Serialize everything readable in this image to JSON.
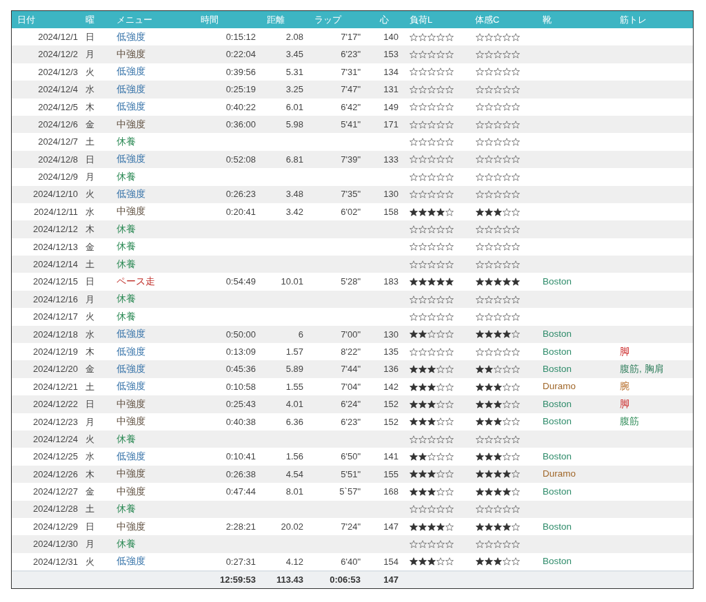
{
  "table": {
    "columns": [
      "日付",
      "曜",
      "メニュー",
      "時間",
      "距離",
      "ラップ",
      "心",
      "負荷L",
      "体感C",
      "靴",
      "筋トレ"
    ],
    "rows": [
      {
        "date": "2024/12/1",
        "weekday": "日",
        "menu": {
          "text": "低強度",
          "color": "#2f6ea6"
        },
        "time": "0:15:12",
        "distance": "2.08",
        "lap": "7'17\"",
        "heart": "140",
        "load": {
          "stars": 0
        },
        "feel": {
          "stars": 0
        }
      },
      {
        "date": "2024/12/2",
        "weekday": "月",
        "menu": {
          "text": "中強度",
          "color": "#5b4b3b"
        },
        "time": "0:22:04",
        "distance": "3.45",
        "lap": "6'23\"",
        "heart": "153",
        "load": {
          "stars": 0
        },
        "feel": {
          "stars": 0
        }
      },
      {
        "date": "2024/12/3",
        "weekday": "火",
        "menu": {
          "text": "低強度",
          "color": "#2f6ea6"
        },
        "time": "0:39:56",
        "distance": "5.31",
        "lap": "7'31\"",
        "heart": "134",
        "load": {
          "stars": 0
        },
        "feel": {
          "stars": 0
        }
      },
      {
        "date": "2024/12/4",
        "weekday": "水",
        "menu": {
          "text": "低強度",
          "color": "#2f6ea6"
        },
        "time": "0:25:19",
        "distance": "3.25",
        "lap": "7'47\"",
        "heart": "131",
        "load": {
          "stars": 0
        },
        "feel": {
          "stars": 0
        }
      },
      {
        "date": "2024/12/5",
        "weekday": "木",
        "menu": {
          "text": "低強度",
          "color": "#2f6ea6"
        },
        "time": "0:40:22",
        "distance": "6.01",
        "lap": "6'42\"",
        "heart": "149",
        "load": {
          "stars": 0
        },
        "feel": {
          "stars": 0
        }
      },
      {
        "date": "2024/12/6",
        "weekday": "金",
        "menu": {
          "text": "中強度",
          "color": "#5b4b3b"
        },
        "time": "0:36:00",
        "distance": "5.98",
        "lap": "5'41\"",
        "heart": "171",
        "load": {
          "stars": 0
        },
        "feel": {
          "stars": 0
        }
      },
      {
        "date": "2024/12/7",
        "weekday": "土",
        "menu": {
          "text": "休養",
          "color": "#2e8b57"
        },
        "load": {
          "stars": 0
        },
        "feel": {
          "stars": 0
        }
      },
      {
        "date": "2024/12/8",
        "weekday": "日",
        "menu": {
          "text": "低強度",
          "color": "#2f6ea6"
        },
        "time": "0:52:08",
        "distance": "6.81",
        "lap": "7'39\"",
        "heart": "133",
        "load": {
          "stars": 0
        },
        "feel": {
          "stars": 0
        }
      },
      {
        "date": "2024/12/9",
        "weekday": "月",
        "menu": {
          "text": "休養",
          "color": "#2e8b57"
        },
        "load": {
          "stars": 0
        },
        "feel": {
          "stars": 0
        }
      },
      {
        "date": "2024/12/10",
        "weekday": "火",
        "menu": {
          "text": "低強度",
          "color": "#2f6ea6"
        },
        "time": "0:26:23",
        "distance": "3.48",
        "lap": "7'35\"",
        "heart": "130",
        "load": {
          "stars": 0
        },
        "feel": {
          "stars": 0
        }
      },
      {
        "date": "2024/12/11",
        "weekday": "水",
        "menu": {
          "text": "中強度",
          "color": "#5b4b3b"
        },
        "time": "0:20:41",
        "distance": "3.42",
        "lap": "6'02\"",
        "heart": "158",
        "load": {
          "stars": 4
        },
        "feel": {
          "stars": 3
        }
      },
      {
        "date": "2024/12/12",
        "weekday": "木",
        "menu": {
          "text": "休養",
          "color": "#2e8b57"
        },
        "load": {
          "stars": 0
        },
        "feel": {
          "stars": 0
        }
      },
      {
        "date": "2024/12/13",
        "weekday": "金",
        "menu": {
          "text": "休養",
          "color": "#2e8b57"
        },
        "load": {
          "stars": 0
        },
        "feel": {
          "stars": 0
        }
      },
      {
        "date": "2024/12/14",
        "weekday": "土",
        "menu": {
          "text": "休養",
          "color": "#2e8b57"
        },
        "load": {
          "stars": 0
        },
        "feel": {
          "stars": 0
        }
      },
      {
        "date": "2024/12/15",
        "weekday": "日",
        "menu": {
          "text": "ペース走",
          "color": "#c0302b"
        },
        "time": "0:54:49",
        "distance": "10.01",
        "lap": "5'28\"",
        "heart": "183",
        "load": {
          "stars": 5
        },
        "feel": {
          "stars": 5
        },
        "shoes": {
          "text": "Boston",
          "color": "#2e8b6a"
        }
      },
      {
        "date": "2024/12/16",
        "weekday": "月",
        "menu": {
          "text": "休養",
          "color": "#2e8b57"
        },
        "load": {
          "stars": 0
        },
        "feel": {
          "stars": 0
        }
      },
      {
        "date": "2024/12/17",
        "weekday": "火",
        "menu": {
          "text": "休養",
          "color": "#2e8b57"
        },
        "load": {
          "stars": 0
        },
        "feel": {
          "stars": 0
        }
      },
      {
        "date": "2024/12/18",
        "weekday": "水",
        "menu": {
          "text": "低強度",
          "color": "#2f6ea6"
        },
        "time": "0:50:00",
        "distance": "6",
        "lap": "7'00\"",
        "heart": "130",
        "load": {
          "stars": 2
        },
        "feel": {
          "stars": 4
        },
        "shoes": {
          "text": "Boston",
          "color": "#2e8b6a"
        }
      },
      {
        "date": "2024/12/19",
        "weekday": "木",
        "menu": {
          "text": "低強度",
          "color": "#2f6ea6"
        },
        "time": "0:13:09",
        "distance": "1.57",
        "lap": "8'22\"",
        "heart": "135",
        "load": {
          "stars": 0
        },
        "feel": {
          "stars": 0
        },
        "shoes": {
          "text": "Boston",
          "color": "#2e8b6a"
        },
        "strength": {
          "text": "脚",
          "color": "#cc2a2a"
        }
      },
      {
        "date": "2024/12/20",
        "weekday": "金",
        "menu": {
          "text": "低強度",
          "color": "#2f6ea6"
        },
        "time": "0:45:36",
        "distance": "5.89",
        "lap": "7'44\"",
        "heart": "136",
        "load": {
          "stars": 3
        },
        "feel": {
          "stars": 2
        },
        "shoes": {
          "text": "Boston",
          "color": "#2e8b6a"
        },
        "strength": {
          "text": "腹筋, 胸肩",
          "color": "#2e7d5b"
        }
      },
      {
        "date": "2024/12/21",
        "weekday": "土",
        "menu": {
          "text": "低強度",
          "color": "#2f6ea6"
        },
        "time": "0:10:58",
        "distance": "1.55",
        "lap": "7'04\"",
        "heart": "142",
        "load": {
          "stars": 3
        },
        "feel": {
          "stars": 3
        },
        "shoes": {
          "text": "Duramo",
          "color": "#a0672a"
        },
        "strength": {
          "text": "腕",
          "color": "#b8702e"
        }
      },
      {
        "date": "2024/12/22",
        "weekday": "日",
        "menu": {
          "text": "中強度",
          "color": "#5b4b3b"
        },
        "time": "0:25:43",
        "distance": "4.01",
        "lap": "6'24\"",
        "heart": "152",
        "load": {
          "stars": 3
        },
        "feel": {
          "stars": 3
        },
        "shoes": {
          "text": "Boston",
          "color": "#2e8b6a"
        },
        "strength": {
          "text": "脚",
          "color": "#cc2a2a"
        }
      },
      {
        "date": "2024/12/23",
        "weekday": "月",
        "menu": {
          "text": "中強度",
          "color": "#5b4b3b"
        },
        "time": "0:40:38",
        "distance": "6.36",
        "lap": "6'23\"",
        "heart": "152",
        "load": {
          "stars": 3
        },
        "feel": {
          "stars": 3
        },
        "shoes": {
          "text": "Boston",
          "color": "#2e8b6a"
        },
        "strength": {
          "text": "腹筋",
          "color": "#2e8b57"
        }
      },
      {
        "date": "2024/12/24",
        "weekday": "火",
        "menu": {
          "text": "休養",
          "color": "#2e8b57"
        },
        "load": {
          "stars": 0
        },
        "feel": {
          "stars": 0
        }
      },
      {
        "date": "2024/12/25",
        "weekday": "水",
        "menu": {
          "text": "低強度",
          "color": "#2f6ea6"
        },
        "time": "0:10:41",
        "distance": "1.56",
        "lap": "6'50\"",
        "heart": "141",
        "load": {
          "stars": 2
        },
        "feel": {
          "stars": 3
        },
        "shoes": {
          "text": "Boston",
          "color": "#2e8b6a"
        }
      },
      {
        "date": "2024/12/26",
        "weekday": "木",
        "menu": {
          "text": "中強度",
          "color": "#5b4b3b"
        },
        "time": "0:26:38",
        "distance": "4.54",
        "lap": "5'51\"",
        "heart": "155",
        "load": {
          "stars": 3
        },
        "feel": {
          "stars": 4
        },
        "shoes": {
          "text": "Duramo",
          "color": "#a0672a"
        }
      },
      {
        "date": "2024/12/27",
        "weekday": "金",
        "menu": {
          "text": "中強度",
          "color": "#5b4b3b"
        },
        "time": "0:47:44",
        "distance": "8.01",
        "lap": "5`57\"",
        "heart": "168",
        "load": {
          "stars": 3
        },
        "feel": {
          "stars": 4
        },
        "shoes": {
          "text": "Boston",
          "color": "#2e8b6a"
        }
      },
      {
        "date": "2024/12/28",
        "weekday": "土",
        "menu": {
          "text": "休養",
          "color": "#2e8b57"
        },
        "load": {
          "stars": 0
        },
        "feel": {
          "stars": 0
        }
      },
      {
        "date": "2024/12/29",
        "weekday": "日",
        "menu": {
          "text": "中強度",
          "color": "#5b4b3b"
        },
        "time": "2:28:21",
        "distance": "20.02",
        "lap": "7'24\"",
        "heart": "147",
        "load": {
          "stars": 4
        },
        "feel": {
          "stars": 4
        },
        "shoes": {
          "text": "Boston",
          "color": "#2e8b6a"
        }
      },
      {
        "date": "2024/12/30",
        "weekday": "月",
        "menu": {
          "text": "休養",
          "color": "#2e8b57"
        },
        "load": {
          "stars": 0
        },
        "feel": {
          "stars": 0
        }
      },
      {
        "date": "2024/12/31",
        "weekday": "火",
        "menu": {
          "text": "低強度",
          "color": "#2f6ea6"
        },
        "time": "0:27:31",
        "distance": "4.12",
        "lap": "6'40\"",
        "heart": "154",
        "load": {
          "stars": 3
        },
        "feel": {
          "stars": 3
        },
        "shoes": {
          "text": "Boston",
          "color": "#2e8b6a"
        }
      }
    ],
    "totals": {
      "time": "12:59:53",
      "distance": "113.43",
      "lap": "0:06:53",
      "heart": "147"
    }
  }
}
